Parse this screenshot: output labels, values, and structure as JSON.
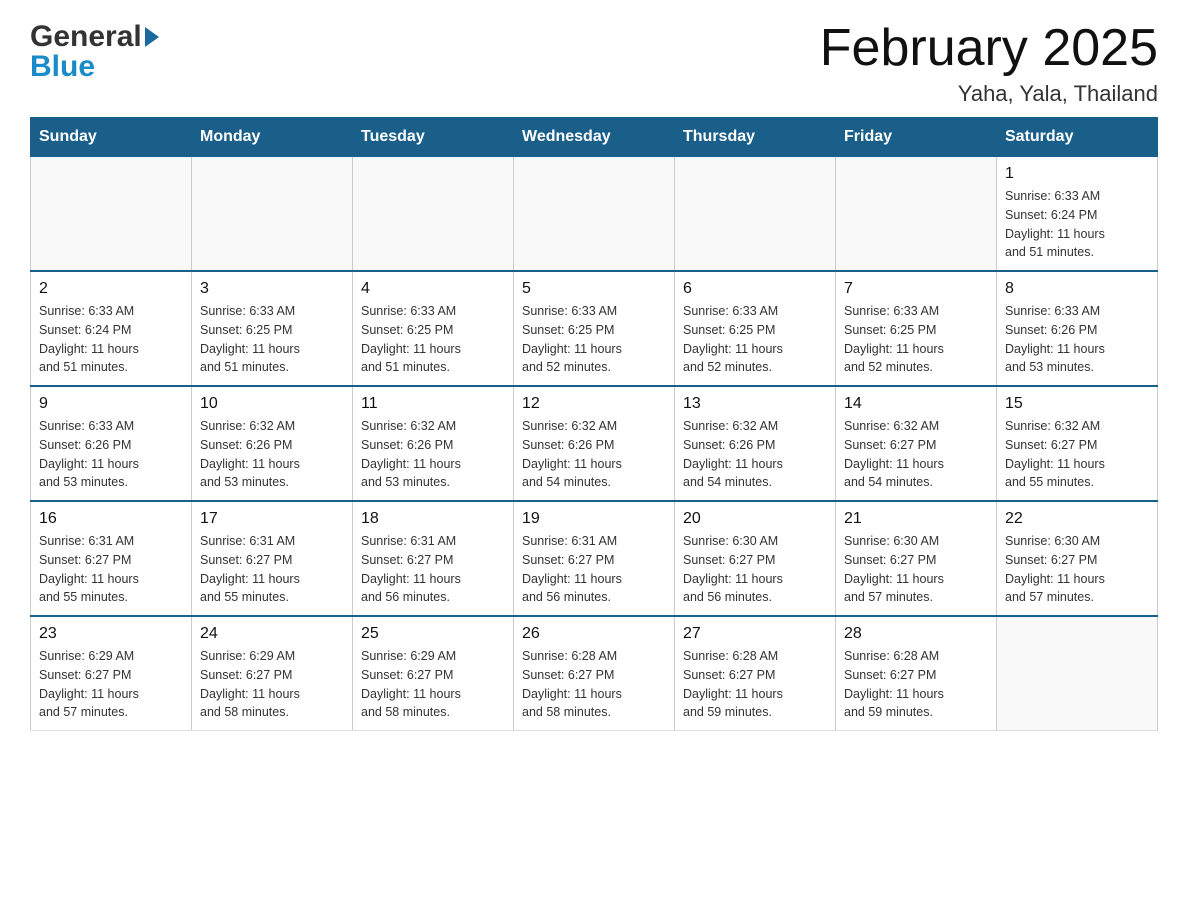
{
  "logo": {
    "general": "General",
    "blue": "Blue"
  },
  "title": "February 2025",
  "location": "Yaha, Yala, Thailand",
  "weekdays": [
    "Sunday",
    "Monday",
    "Tuesday",
    "Wednesday",
    "Thursday",
    "Friday",
    "Saturday"
  ],
  "weeks": [
    [
      {
        "day": "",
        "info": ""
      },
      {
        "day": "",
        "info": ""
      },
      {
        "day": "",
        "info": ""
      },
      {
        "day": "",
        "info": ""
      },
      {
        "day": "",
        "info": ""
      },
      {
        "day": "",
        "info": ""
      },
      {
        "day": "1",
        "info": "Sunrise: 6:33 AM\nSunset: 6:24 PM\nDaylight: 11 hours\nand 51 minutes."
      }
    ],
    [
      {
        "day": "2",
        "info": "Sunrise: 6:33 AM\nSunset: 6:24 PM\nDaylight: 11 hours\nand 51 minutes."
      },
      {
        "day": "3",
        "info": "Sunrise: 6:33 AM\nSunset: 6:25 PM\nDaylight: 11 hours\nand 51 minutes."
      },
      {
        "day": "4",
        "info": "Sunrise: 6:33 AM\nSunset: 6:25 PM\nDaylight: 11 hours\nand 51 minutes."
      },
      {
        "day": "5",
        "info": "Sunrise: 6:33 AM\nSunset: 6:25 PM\nDaylight: 11 hours\nand 52 minutes."
      },
      {
        "day": "6",
        "info": "Sunrise: 6:33 AM\nSunset: 6:25 PM\nDaylight: 11 hours\nand 52 minutes."
      },
      {
        "day": "7",
        "info": "Sunrise: 6:33 AM\nSunset: 6:25 PM\nDaylight: 11 hours\nand 52 minutes."
      },
      {
        "day": "8",
        "info": "Sunrise: 6:33 AM\nSunset: 6:26 PM\nDaylight: 11 hours\nand 53 minutes."
      }
    ],
    [
      {
        "day": "9",
        "info": "Sunrise: 6:33 AM\nSunset: 6:26 PM\nDaylight: 11 hours\nand 53 minutes."
      },
      {
        "day": "10",
        "info": "Sunrise: 6:32 AM\nSunset: 6:26 PM\nDaylight: 11 hours\nand 53 minutes."
      },
      {
        "day": "11",
        "info": "Sunrise: 6:32 AM\nSunset: 6:26 PM\nDaylight: 11 hours\nand 53 minutes."
      },
      {
        "day": "12",
        "info": "Sunrise: 6:32 AM\nSunset: 6:26 PM\nDaylight: 11 hours\nand 54 minutes."
      },
      {
        "day": "13",
        "info": "Sunrise: 6:32 AM\nSunset: 6:26 PM\nDaylight: 11 hours\nand 54 minutes."
      },
      {
        "day": "14",
        "info": "Sunrise: 6:32 AM\nSunset: 6:27 PM\nDaylight: 11 hours\nand 54 minutes."
      },
      {
        "day": "15",
        "info": "Sunrise: 6:32 AM\nSunset: 6:27 PM\nDaylight: 11 hours\nand 55 minutes."
      }
    ],
    [
      {
        "day": "16",
        "info": "Sunrise: 6:31 AM\nSunset: 6:27 PM\nDaylight: 11 hours\nand 55 minutes."
      },
      {
        "day": "17",
        "info": "Sunrise: 6:31 AM\nSunset: 6:27 PM\nDaylight: 11 hours\nand 55 minutes."
      },
      {
        "day": "18",
        "info": "Sunrise: 6:31 AM\nSunset: 6:27 PM\nDaylight: 11 hours\nand 56 minutes."
      },
      {
        "day": "19",
        "info": "Sunrise: 6:31 AM\nSunset: 6:27 PM\nDaylight: 11 hours\nand 56 minutes."
      },
      {
        "day": "20",
        "info": "Sunrise: 6:30 AM\nSunset: 6:27 PM\nDaylight: 11 hours\nand 56 minutes."
      },
      {
        "day": "21",
        "info": "Sunrise: 6:30 AM\nSunset: 6:27 PM\nDaylight: 11 hours\nand 57 minutes."
      },
      {
        "day": "22",
        "info": "Sunrise: 6:30 AM\nSunset: 6:27 PM\nDaylight: 11 hours\nand 57 minutes."
      }
    ],
    [
      {
        "day": "23",
        "info": "Sunrise: 6:29 AM\nSunset: 6:27 PM\nDaylight: 11 hours\nand 57 minutes."
      },
      {
        "day": "24",
        "info": "Sunrise: 6:29 AM\nSunset: 6:27 PM\nDaylight: 11 hours\nand 58 minutes."
      },
      {
        "day": "25",
        "info": "Sunrise: 6:29 AM\nSunset: 6:27 PM\nDaylight: 11 hours\nand 58 minutes."
      },
      {
        "day": "26",
        "info": "Sunrise: 6:28 AM\nSunset: 6:27 PM\nDaylight: 11 hours\nand 58 minutes."
      },
      {
        "day": "27",
        "info": "Sunrise: 6:28 AM\nSunset: 6:27 PM\nDaylight: 11 hours\nand 59 minutes."
      },
      {
        "day": "28",
        "info": "Sunrise: 6:28 AM\nSunset: 6:27 PM\nDaylight: 11 hours\nand 59 minutes."
      },
      {
        "day": "",
        "info": ""
      }
    ]
  ]
}
